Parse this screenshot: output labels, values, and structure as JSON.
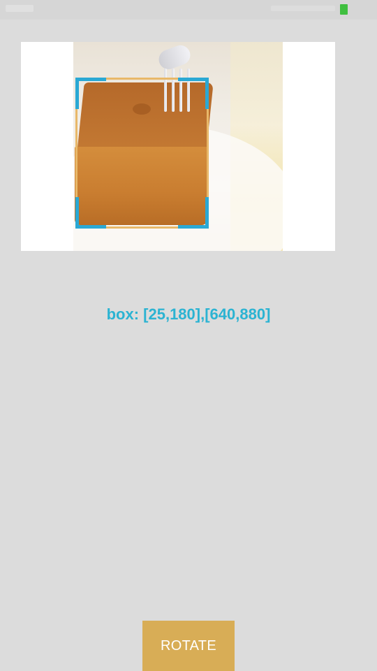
{
  "status_bar": {
    "battery_color": "#3fbf3f"
  },
  "preview": {
    "image_subject": "cake cube with fork",
    "box_color": "#e8b869",
    "corner_color": "#2aa8d4"
  },
  "result": {
    "box_text": "box: [25,180],[640,880]",
    "text_color": "#2bb3d2"
  },
  "actions": {
    "rotate_label": "ROTATE",
    "button_color": "#d8ad56"
  }
}
